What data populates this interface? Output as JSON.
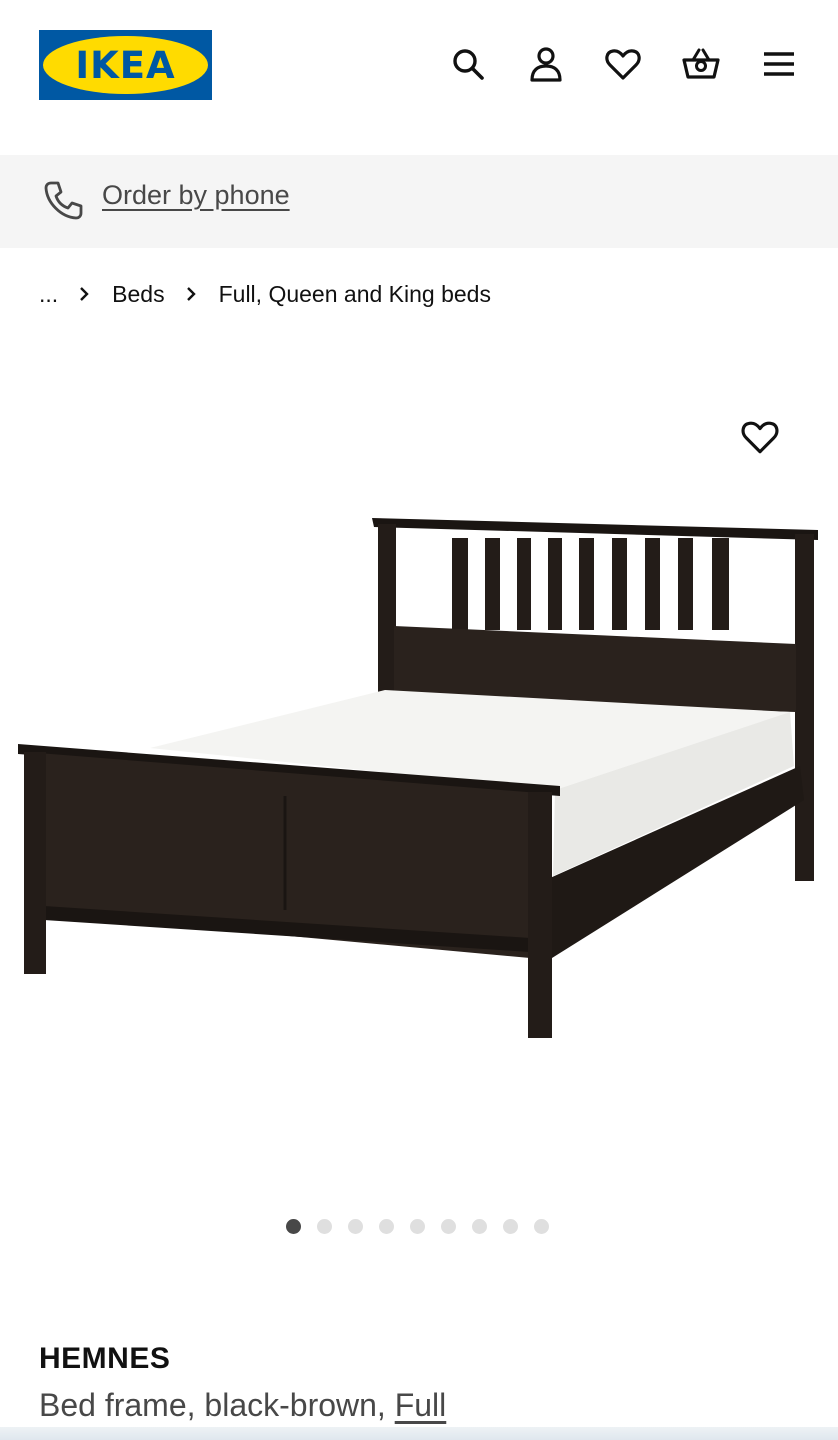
{
  "brand": {
    "logo_text": "IKEA",
    "blue": "#0058a3",
    "yellow": "#ffdb00"
  },
  "header": {
    "icons": [
      "search-icon",
      "account-icon",
      "heart-icon",
      "basket-icon",
      "hamburger-menu-icon"
    ]
  },
  "phone_bar": {
    "icon": "phone-icon",
    "label": "Order by phone"
  },
  "breadcrumb": {
    "items": [
      "...",
      "Beds",
      "Full, Queen and King beds"
    ]
  },
  "product_image": {
    "favourite_icon": "heart-icon"
  },
  "carousel": {
    "total": 9,
    "active": 1
  },
  "product": {
    "name": "HEMNES",
    "description": "Bed frame, black-brown, ",
    "size": "Full"
  }
}
